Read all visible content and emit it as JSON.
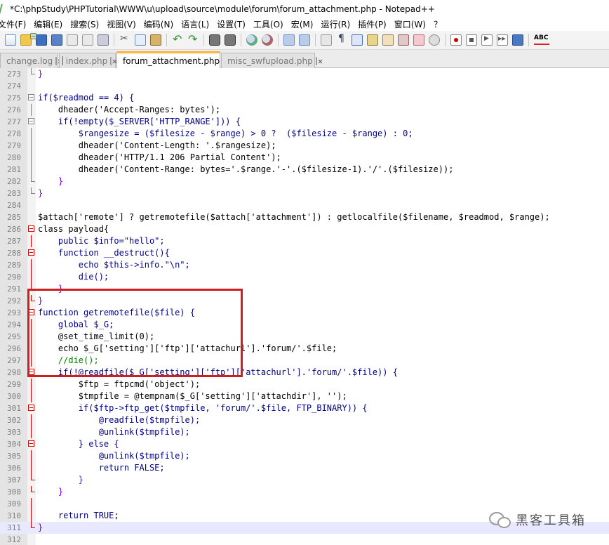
{
  "window": {
    "title": "*C:\\phpStudy\\PHPTutorial\\WWW\\u\\upload\\source\\module\\forum\\forum_attachment.php - Notepad++"
  },
  "menu": [
    "文件(F)",
    "编辑(E)",
    "搜索(S)",
    "视图(V)",
    "编码(N)",
    "语言(L)",
    "设置(T)",
    "工具(O)",
    "宏(M)",
    "运行(R)",
    "插件(P)",
    "窗口(W)",
    "？"
  ],
  "toolbar": {
    "icons": [
      "new-file-icon",
      "open-file-icon",
      "save-icon",
      "save-all-icon",
      "close-icon",
      "close-all-icon",
      "print-icon",
      "cut-icon",
      "copy-icon",
      "paste-icon",
      "undo-icon",
      "redo-icon",
      "find-icon",
      "replace-icon",
      "zoom-in-icon",
      "zoom-out-icon",
      "sync-vertical-icon",
      "sync-horizontal-icon",
      "word-wrap-icon",
      "show-all-chars-icon",
      "indent-guide-icon",
      "fold-all-icon",
      "user-defined-language-icon",
      "document-map-icon",
      "function-list-icon",
      "folder-workspace-icon",
      "monitoring-icon",
      "macro-record-icon",
      "macro-stop-icon",
      "macro-play-icon",
      "macro-play-multiple-icon",
      "macro-save-icon",
      "spell-check-icon"
    ],
    "spell_label": "ABC"
  },
  "tabs": [
    {
      "label": "change.log",
      "active": false
    },
    {
      "label": "index.php",
      "active": false
    },
    {
      "label": "forum_attachment.php",
      "active": true
    },
    {
      "label": "misc_swfupload.php",
      "active": false
    }
  ],
  "editor": {
    "line_numbers": [
      "273",
      "274",
      "275",
      "276",
      "277",
      "278",
      "279",
      "280",
      "281",
      "282",
      "283",
      "284",
      "285",
      "286",
      "287",
      "288",
      "289",
      "290",
      "291",
      "292",
      "293",
      "294",
      "295",
      "296",
      "297",
      "298",
      "299",
      "300",
      "301",
      "302",
      "303",
      "304",
      "305",
      "306",
      "307",
      "308",
      "309",
      "310",
      "311",
      "312"
    ],
    "lines": [
      "}",
      "",
      "if($readmod == 4) {",
      "    dheader('Accept-Ranges: bytes');",
      "    if(!empty($_SERVER['HTTP_RANGE'])) {",
      "        $rangesize = ($filesize - $range) > 0 ?  ($filesize - $range) : 0;",
      "        dheader('Content-Length: '.$rangesize);",
      "        dheader('HTTP/1.1 206 Partial Content');",
      "        dheader('Content-Range: bytes='.$range.'-'.($filesize-1).'/'.($filesize));",
      "    }",
      "}",
      "",
      "$attach['remote'] ? getremotefile($attach['attachment']) : getlocalfile($filename, $readmod, $range);",
      "class payload{",
      "    public $info=\"hello\";",
      "    function __destruct(){",
      "        echo $this->info.\"\\n\";",
      "        die();",
      "    }",
      "}",
      "function getremotefile($file) {",
      "    global $_G;",
      "    @set_time_limit(0);",
      "    echo $_G['setting']['ftp']['attachurl'].'forum/'.$file;",
      "    //die();",
      "    if(!@readfile($_G['setting']['ftp']['attachurl'].'forum/'.$file)) {",
      "        $ftp = ftpcmd('object');",
      "        $tmpfile = @tempnam($_G['setting']['attachdir'], '');",
      "        if($ftp->ftp_get($tmpfile, 'forum/'.$file, FTP_BINARY)) {",
      "            @readfile($tmpfile);",
      "            @unlink($tmpfile);",
      "        } else {",
      "            @unlink($tmpfile);",
      "            return FALSE;",
      "        }",
      "    }",
      "",
      "    return TRUE;",
      "}",
      ""
    ]
  },
  "watermark": {
    "text": "黑客工具箱",
    "icon": "wechat-icon"
  },
  "colors": {
    "highlight_box": "#d01e1e",
    "active_tab_accent": "#ffb43d",
    "keyword": "#00008b",
    "string": "#808080",
    "number": "#ff8000",
    "comment": "#008000",
    "operator": "#8000ff"
  }
}
